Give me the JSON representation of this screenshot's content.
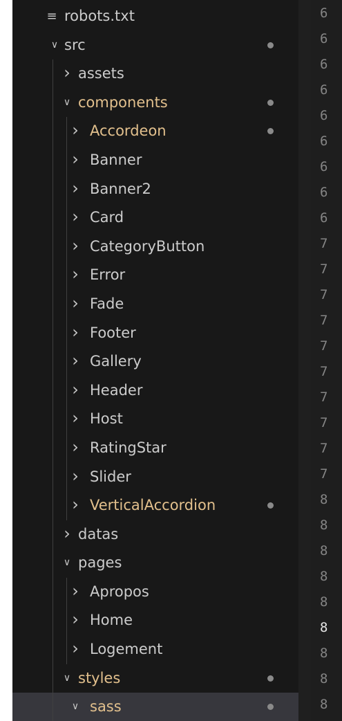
{
  "explorer": {
    "items": [
      {
        "label": "robots.txt",
        "kind": "file",
        "icon": "lines-file-icon",
        "depth": 1,
        "modified": false
      },
      {
        "label": "src",
        "kind": "folder",
        "expanded": true,
        "depth": 1,
        "modified": false,
        "dot": true
      },
      {
        "label": "assets",
        "kind": "folder",
        "expanded": false,
        "depth": 2,
        "modified": false
      },
      {
        "label": "components",
        "kind": "folder",
        "expanded": true,
        "depth": 2,
        "modified": true,
        "dot": true
      },
      {
        "label": "Accordeon",
        "kind": "folder",
        "expanded": false,
        "depth": 3,
        "modified": true,
        "dot": true
      },
      {
        "label": "Banner",
        "kind": "folder",
        "expanded": false,
        "depth": 3,
        "modified": false
      },
      {
        "label": "Banner2",
        "kind": "folder",
        "expanded": false,
        "depth": 3,
        "modified": false
      },
      {
        "label": "Card",
        "kind": "folder",
        "expanded": false,
        "depth": 3,
        "modified": false
      },
      {
        "label": "CategoryButton",
        "kind": "folder",
        "expanded": false,
        "depth": 3,
        "modified": false
      },
      {
        "label": "Error",
        "kind": "folder",
        "expanded": false,
        "depth": 3,
        "modified": false
      },
      {
        "label": "Fade",
        "kind": "folder",
        "expanded": false,
        "depth": 3,
        "modified": false
      },
      {
        "label": "Footer",
        "kind": "folder",
        "expanded": false,
        "depth": 3,
        "modified": false
      },
      {
        "label": "Gallery",
        "kind": "folder",
        "expanded": false,
        "depth": 3,
        "modified": false
      },
      {
        "label": "Header",
        "kind": "folder",
        "expanded": false,
        "depth": 3,
        "modified": false
      },
      {
        "label": "Host",
        "kind": "folder",
        "expanded": false,
        "depth": 3,
        "modified": false
      },
      {
        "label": "RatingStar",
        "kind": "folder",
        "expanded": false,
        "depth": 3,
        "modified": false
      },
      {
        "label": "Slider",
        "kind": "folder",
        "expanded": false,
        "depth": 3,
        "modified": false
      },
      {
        "label": "VerticalAccordion",
        "kind": "folder",
        "expanded": false,
        "depth": 3,
        "modified": true,
        "dot": true
      },
      {
        "label": "datas",
        "kind": "folder",
        "expanded": false,
        "depth": 2,
        "modified": false
      },
      {
        "label": "pages",
        "kind": "folder",
        "expanded": true,
        "depth": 2,
        "modified": false
      },
      {
        "label": "Apropos",
        "kind": "folder",
        "expanded": false,
        "depth": 3,
        "modified": false
      },
      {
        "label": "Home",
        "kind": "folder",
        "expanded": false,
        "depth": 3,
        "modified": false
      },
      {
        "label": "Logement",
        "kind": "folder",
        "expanded": false,
        "depth": 3,
        "modified": false
      },
      {
        "label": "styles",
        "kind": "folder",
        "expanded": true,
        "depth": 2,
        "modified": true,
        "dot": true
      },
      {
        "label": "sass",
        "kind": "folder",
        "expanded": true,
        "depth": 3,
        "modified": true,
        "dot": true,
        "selected": true
      }
    ]
  },
  "gutter": {
    "line_numbers": [
      "6",
      "6",
      "6",
      "6",
      "6",
      "6",
      "6",
      "6",
      "6",
      "7",
      "7",
      "7",
      "7",
      "7",
      "7",
      "7",
      "7",
      "7",
      "7",
      "8",
      "8",
      "8",
      "8",
      "8",
      "8",
      "8",
      "8",
      "8"
    ],
    "current_index": 24
  },
  "colors": {
    "sidebar_bg": "#181818",
    "editor_bg": "#1e1e1e",
    "text": "#cccccc",
    "modified_text": "#e2c08d",
    "dot": "#8a8a8a",
    "selected_bg": "#37373d",
    "line_number": "#858585"
  }
}
